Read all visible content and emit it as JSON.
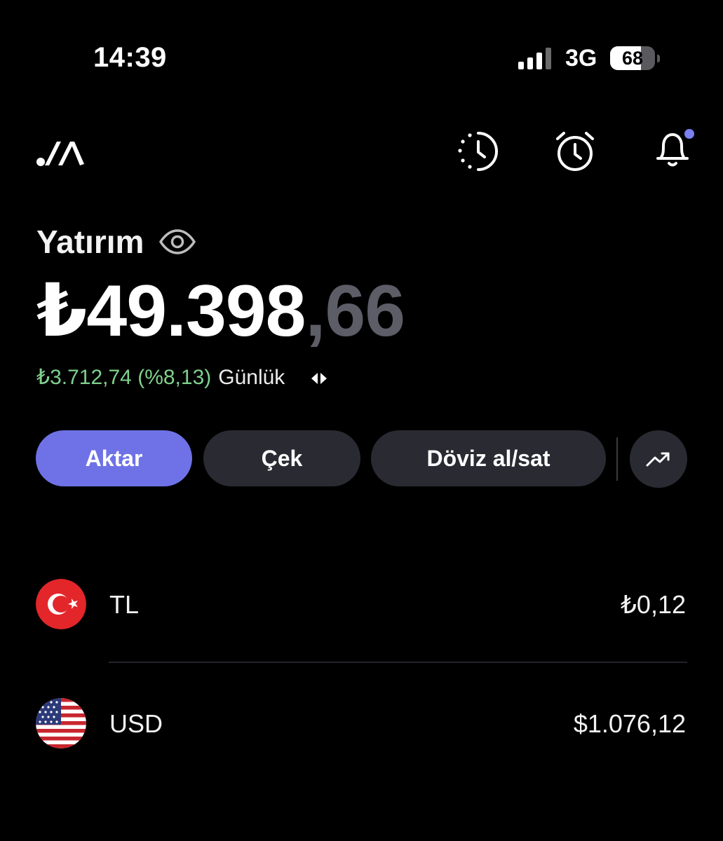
{
  "status_bar": {
    "time": "14:39",
    "network": "3G",
    "battery": "68",
    "battery_level": 0.68
  },
  "header": {
    "logo_icon": "app-logo-icon",
    "icons": [
      "history-clock-icon",
      "alarm-clock-icon",
      "bell-icon"
    ],
    "notification_dot_color": "#7b7ff0"
  },
  "portfolio": {
    "title": "Yatırım",
    "balance_whole": "₺49.398",
    "balance_decimal": ",66",
    "change": "₺3.712,74 (%8,13)",
    "period": "Günlük"
  },
  "actions": {
    "transfer": "Aktar",
    "withdraw": "Çek",
    "exchange": "Döviz al/sat",
    "trend_icon": "trending-up-icon"
  },
  "currencies": [
    {
      "name": "TL",
      "amount": "₺0,12",
      "flag": "turkey-flag-icon"
    },
    {
      "name": "USD",
      "amount": "$1.076,12",
      "flag": "usa-flag-icon"
    }
  ],
  "colors": {
    "background": "#000000",
    "primary": "#6f72e6",
    "button": "#2a2a33",
    "positive": "#7fd08c"
  }
}
